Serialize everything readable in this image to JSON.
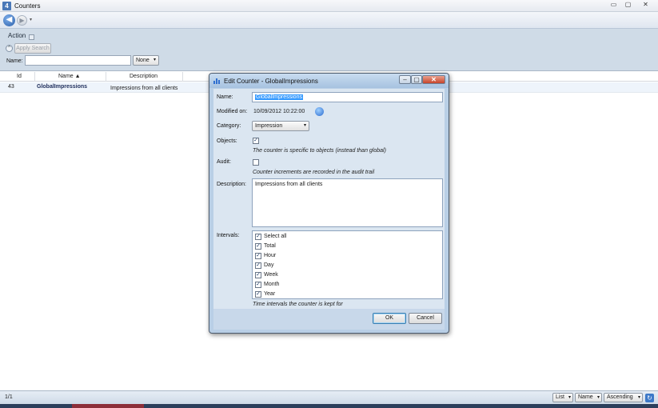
{
  "window": {
    "app_icon": "4",
    "title": "Counters",
    "ghost_menus": [
      "",
      "",
      "",
      "",
      ""
    ],
    "controls": [
      "▭",
      "▢",
      "✕"
    ]
  },
  "nav": {
    "back_icon": "back-arrow-icon",
    "forward_icon": "forward-arrow-icon",
    "back_glyph": "◀",
    "fwd_glyph": "▶",
    "dropdown_glyph": "▾"
  },
  "toolbar": {
    "action_label": "Action",
    "collapse_glyph": "^",
    "apply_search_label": "Apply Search",
    "name_label": "Name:",
    "name_value": "",
    "filter_value": "None",
    "caret": "▾"
  },
  "grid": {
    "columns": [
      {
        "label": "Id"
      },
      {
        "label": "Name ▲"
      },
      {
        "label": "Description"
      }
    ],
    "rows": [
      {
        "id": "43",
        "name": "GlobalImpressions",
        "description": "Impressions from all clients"
      }
    ]
  },
  "status": {
    "page_count": "1/1",
    "view_mode": "List",
    "sort_field": "Name",
    "sort_order": "Ascending",
    "refresh_glyph": "↻"
  },
  "dialog": {
    "title": "Edit Counter - GlobalImpressions",
    "controls": [
      "–",
      "▢",
      "✕"
    ],
    "name_label": "Name:",
    "name_value": "GlobalImpressions",
    "modified_label": "Modified on:",
    "modified_value": "10/09/2012    10:22:00",
    "category_label": "Category:",
    "category_value": "Impression",
    "objects_label": "Objects:",
    "objects_checked": true,
    "objects_hint": "The counter is specific to objects (instead than global)",
    "audit_label": "Audit:",
    "audit_checked": false,
    "audit_hint": "Counter increments are recorded in the audit trail",
    "description_label": "Description:",
    "description_value": "Impressions from all clients",
    "intervals_label": "Intervals:",
    "intervals": [
      {
        "label": "Select all",
        "checked": true
      },
      {
        "label": "Total",
        "checked": true
      },
      {
        "label": "Hour",
        "checked": true
      },
      {
        "label": "Day",
        "checked": true
      },
      {
        "label": "Week",
        "checked": true
      },
      {
        "label": "Month",
        "checked": true
      },
      {
        "label": "Year",
        "checked": true
      }
    ],
    "intervals_hint": "Time intervals the counter is kept for",
    "ok_label": "OK",
    "cancel_label": "Cancel",
    "check_glyph": "✓"
  }
}
